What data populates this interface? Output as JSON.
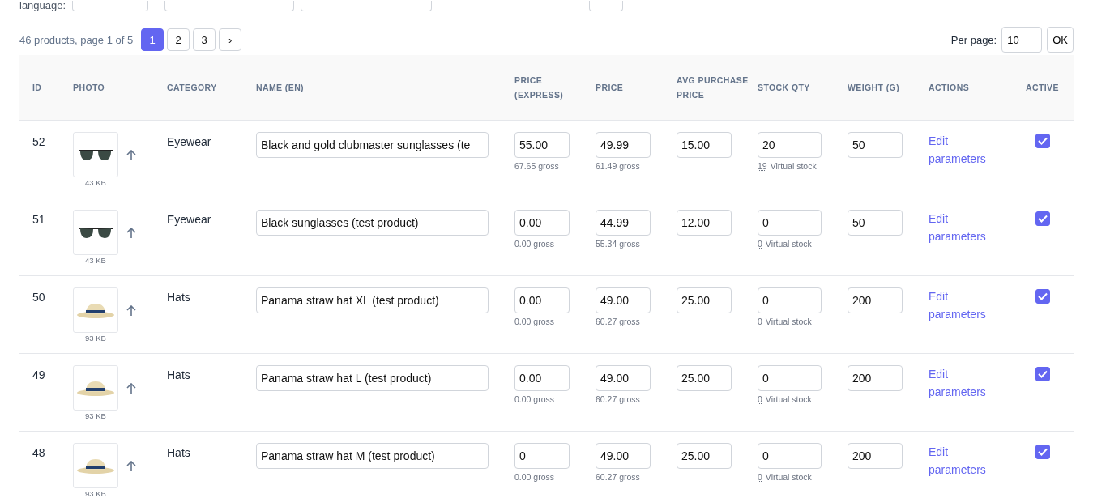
{
  "filters": {
    "label": "language:"
  },
  "pagination": {
    "summary": "46 products, page 1 of 5",
    "pages": [
      {
        "label": "1",
        "selected": true
      },
      {
        "label": "2",
        "selected": false
      },
      {
        "label": "3",
        "selected": false
      }
    ],
    "next": "›",
    "per_page_label": "Per page:",
    "per_page_value": "10",
    "ok": "OK"
  },
  "table": {
    "columns": [
      "ID",
      "PHOTO",
      "CATEGORY",
      "NAME (EN)",
      "PRICE (EXPRESS)",
      "PRICE",
      "AVG PURCHASE PRICE",
      "STOCK QTY",
      "WEIGHT (G)",
      "ACTIONS",
      "ACTIVE"
    ],
    "rows": [
      {
        "id": "52",
        "photo": {
          "kind": "sunglasses",
          "size": "43 KB"
        },
        "category": "Eyewear",
        "name": "Black and gold clubmaster sunglasses (te",
        "price_express": "55.00",
        "price_express_gross": "67.65 gross",
        "price": "49.99",
        "price_gross": "61.49 gross",
        "avg_purchase_price": "15.00",
        "stock_qty": "20",
        "virtual_count": "19",
        "virtual_label": "Virtual stock",
        "weight": "50",
        "action": "Edit parameters",
        "active": true
      },
      {
        "id": "51",
        "photo": {
          "kind": "sunglasses",
          "size": "43 KB"
        },
        "category": "Eyewear",
        "name": "Black sunglasses (test product)",
        "price_express": "0.00",
        "price_express_gross": "0.00 gross",
        "price": "44.99",
        "price_gross": "55.34 gross",
        "avg_purchase_price": "12.00",
        "stock_qty": "0",
        "virtual_count": "0",
        "virtual_label": "Virtual stock",
        "weight": "50",
        "action": "Edit parameters",
        "active": true
      },
      {
        "id": "50",
        "photo": {
          "kind": "hat",
          "size": "93 KB"
        },
        "category": "Hats",
        "name": "Panama straw hat XL (test product)",
        "price_express": "0.00",
        "price_express_gross": "0.00 gross",
        "price": "49.00",
        "price_gross": "60.27 gross",
        "avg_purchase_price": "25.00",
        "stock_qty": "0",
        "virtual_count": "0",
        "virtual_label": "Virtual stock",
        "weight": "200",
        "action": "Edit parameters",
        "active": true
      },
      {
        "id": "49",
        "photo": {
          "kind": "hat",
          "size": "93 KB"
        },
        "category": "Hats",
        "name": "Panama straw hat L (test product)",
        "price_express": "0.00",
        "price_express_gross": "0.00 gross",
        "price": "49.00",
        "price_gross": "60.27 gross",
        "avg_purchase_price": "25.00",
        "stock_qty": "0",
        "virtual_count": "0",
        "virtual_label": "Virtual stock",
        "weight": "200",
        "action": "Edit parameters",
        "active": true
      },
      {
        "id": "48",
        "photo": {
          "kind": "hat",
          "size": "93 KB"
        },
        "category": "Hats",
        "name": "Panama straw hat M (test product)",
        "price_express": "0",
        "price_express_gross": "0.00 gross",
        "price": "49.00",
        "price_gross": "60.27 gross",
        "avg_purchase_price": "25.00",
        "stock_qty": "0",
        "virtual_count": "0",
        "virtual_label": "Virtual stock",
        "weight": "200",
        "action": "Edit parameters",
        "active": true
      }
    ]
  }
}
